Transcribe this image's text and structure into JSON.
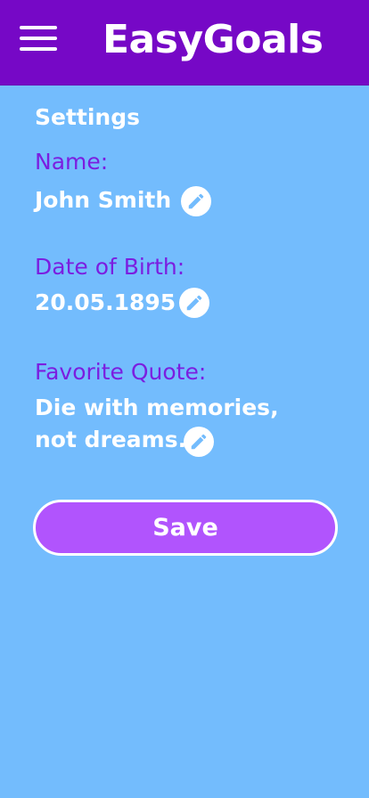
{
  "header": {
    "app_title": "EasyGoals",
    "menu_icon": "hamburger-menu-icon",
    "background_color": "#7608c6"
  },
  "settings": {
    "title": "Settings",
    "name": {
      "label": "Name:",
      "value": "John Smith",
      "edit_icon": "pencil-icon"
    },
    "birth": {
      "label": "Date of Birth:",
      "value": "20.05.1895",
      "edit_icon": "pencil-icon"
    },
    "quote": {
      "label": "Favorite Quote:",
      "value_line1": "Die with memories,",
      "value_line2": "not dreams.",
      "edit_icon": "pencil-icon"
    },
    "save_label": "Save"
  },
  "colors": {
    "background": "#73bcfd",
    "accent": "#7608c6",
    "label": "#7b1ee0",
    "button": "#b154fd"
  }
}
